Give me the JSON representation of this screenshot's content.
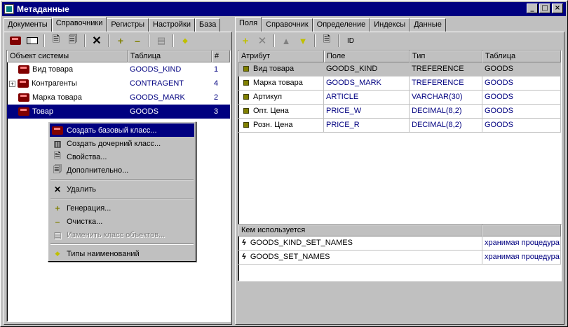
{
  "window": {
    "title": "Метаданные"
  },
  "left": {
    "tabs": [
      "Документы",
      "Справочники",
      "Регистры",
      "Настройки",
      "База"
    ],
    "active_tab": "Справочники",
    "columns": [
      "Объект системы",
      "Таблица",
      "#"
    ],
    "rows": [
      {
        "name": "Вид товара",
        "table": "GOODS_KIND",
        "num": "1"
      },
      {
        "name": "Контрагенты",
        "table": "CONTRAGENT",
        "num": "4"
      },
      {
        "name": "Марка товара",
        "table": "GOODS_MARK",
        "num": "2"
      },
      {
        "name": "Товар",
        "table": "GOODS",
        "num": "3"
      }
    ]
  },
  "right": {
    "tabs": [
      "Поля",
      "Справочник",
      "Определение",
      "Индексы",
      "Данные"
    ],
    "active_tab": "Поля",
    "toolbar_id": "ID",
    "columns": [
      "Атрибут",
      "Поле",
      "Тип",
      "Таблица"
    ],
    "rows": [
      {
        "attr": "Вид товара",
        "field": "GOODS_KIND",
        "type": "TREFERENCE",
        "table": "GOODS"
      },
      {
        "attr": "Марка товара",
        "field": "GOODS_MARK",
        "type": "TREFERENCE",
        "table": "GOODS"
      },
      {
        "attr": "Артикул",
        "field": "ARTICLE",
        "type": "VARCHAR(30)",
        "table": "GOODS"
      },
      {
        "attr": "Опт. Цена",
        "field": "PRICE_W",
        "type": "DECIMAL(8,2)",
        "table": "GOODS"
      },
      {
        "attr": "Розн. Цена",
        "field": "PRICE_R",
        "type": "DECIMAL(8,2)",
        "table": "GOODS"
      }
    ],
    "usage": {
      "header": "Кем используется",
      "rows": [
        {
          "name": "GOODS_KIND_SET_NAMES",
          "kind": "хранимая процедура"
        },
        {
          "name": "GOODS_SET_NAMES",
          "kind": "хранимая процедура"
        }
      ]
    }
  },
  "context_menu": {
    "items": [
      "Создать базовый класс...",
      "Создать дочерний класс...",
      "Свойства...",
      "Дополнительно...",
      "Удалить",
      "Генерация...",
      "Очистка...",
      "Изменить класс объектов...",
      "Типы наименований"
    ]
  }
}
